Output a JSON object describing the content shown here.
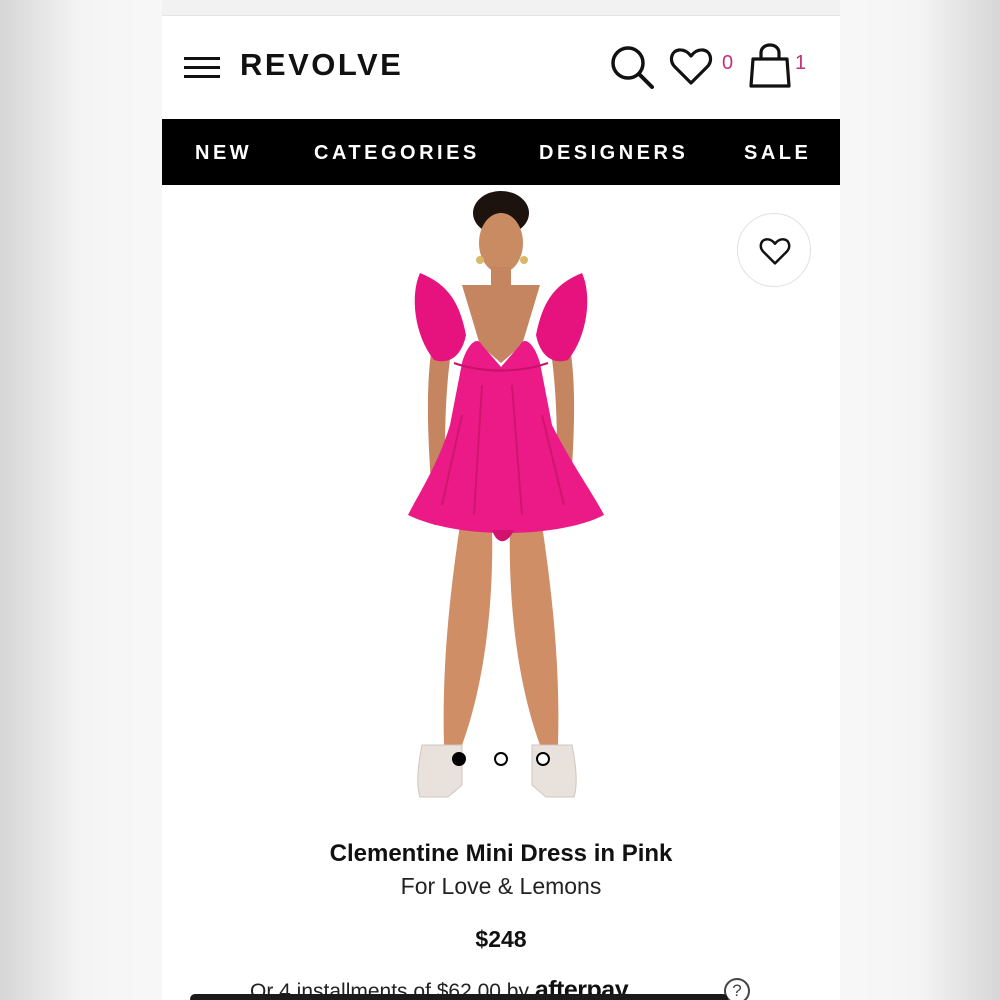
{
  "header": {
    "logo": "REVOLVE",
    "wishlist_count": "0",
    "bag_count": "1"
  },
  "nav": {
    "items": [
      "NEW",
      "CATEGORIES",
      "DESIGNERS",
      "SALE"
    ]
  },
  "product": {
    "title": "Clementine Mini Dress in Pink",
    "brand": "For Love & Lemons",
    "price": "$248",
    "installments_text": "Or 4 installments of $62.00 by",
    "afterpay_label": "afterpay",
    "help_label": "?",
    "image_count": 3,
    "active_image_index": 0
  },
  "colors": {
    "accent_count": "#c2317a",
    "nav_bg": "#000000",
    "dress": "#ec1a86"
  },
  "icons": [
    "menu-icon",
    "search-icon",
    "heart-icon",
    "bag-icon",
    "help-icon"
  ]
}
